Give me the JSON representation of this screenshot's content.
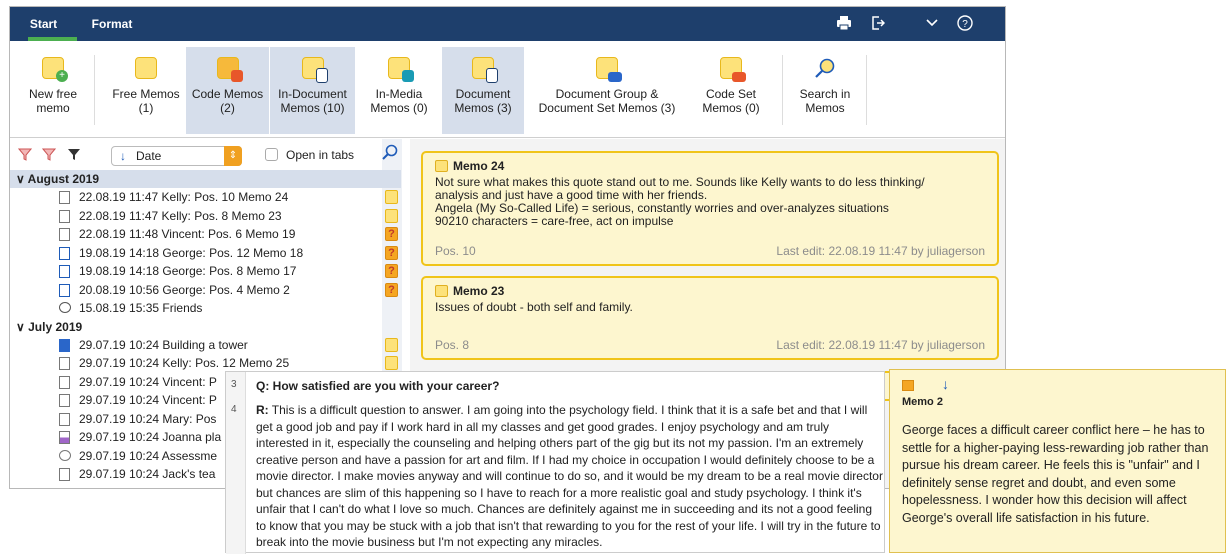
{
  "tabs": {
    "start": "Start",
    "format": "Format"
  },
  "ribbon": [
    {
      "name": "new-free-memo",
      "label": "New free memo",
      "selected": false
    },
    {
      "name": "free-memos",
      "label": "Free Memos (1)",
      "selected": false
    },
    {
      "name": "code-memos",
      "label": "Code Memos (2)",
      "selected": true
    },
    {
      "name": "in-document-memos",
      "label": "In-Document Memos (10)",
      "selected": true
    },
    {
      "name": "in-media-memos",
      "label": "In-Media Memos (0)",
      "selected": false
    },
    {
      "name": "document-memos",
      "label": "Document Memos (3)",
      "selected": true
    },
    {
      "name": "document-group-memos",
      "label": "Document Group & Document Set Memos (3)",
      "selected": false
    },
    {
      "name": "code-set-memos",
      "label": "Code Set Memos (0)",
      "selected": false
    },
    {
      "name": "search-in-memos",
      "label": "Search in Memos",
      "selected": false
    }
  ],
  "ribbon_labels": {
    "new_free_1": "New free",
    "new_free_2": "memo",
    "free_1": "Free Memos",
    "free_2": "(1)",
    "code_1": "Code Memos",
    "code_2": "(2)",
    "indoc_1": "In-Document",
    "indoc_2": "Memos (10)",
    "inmedia_1": "In-Media",
    "inmedia_2": "Memos (0)",
    "docm_1": "Document",
    "docm_2": "Memos (3)",
    "group_1": "Document Group &",
    "group_2": "Document Set Memos (3)",
    "codeset_1": "Code Set",
    "codeset_2": "Memos (0)",
    "search_1": "Search in",
    "search_2": "Memos"
  },
  "filter": {
    "sort": "Date",
    "open_in_tabs": "Open in tabs"
  },
  "groups": [
    {
      "label": "August 2019",
      "rows": [
        "22.08.19  11:47   Kelly: Pos. 10   Memo 24",
        "22.08.19  11:47   Kelly: Pos. 8   Memo 23",
        "22.08.19  11:48   Vincent: Pos. 6   Memo 19",
        "19.08.19  14:18   George: Pos. 12   Memo 18",
        "19.08.19  14:18   George: Pos. 8   Memo 17",
        "20.08.19  10:56   George: Pos. 4   Memo 2",
        "15.08.19  15:35   Friends"
      ]
    },
    {
      "label": "July 2019",
      "rows": [
        "29.07.19  10:24   Building a tower",
        "29.07.19  10:24   Kelly: Pos. 12   Memo 25",
        "29.07.19  10:24   Vincent: P",
        "29.07.19  10:24   Vincent: P",
        "29.07.19  10:24   Mary: Pos",
        "29.07.19  10:24   Joanna pla",
        "29.07.19  10:24   Assessme",
        "29.07.19  10:24   Jack's tea"
      ]
    }
  ],
  "memos": {
    "m24": {
      "title": "Memo 24",
      "line1": "Not sure what makes this quote stand out to me. Sounds like Kelly wants to do less thinking/",
      "line2": "analysis and just have a good time with her friends.",
      "line3": "Angela (My So-Called Life) = serious, constantly worries and over-analyzes situations",
      "line4": "90210 characters = care-free, act on impulse",
      "pos": "Pos. 10",
      "edit": "Last edit: 22.08.19 11:47 by juliagerson"
    },
    "m23": {
      "title": "Memo 23",
      "line1": "Issues of doubt - both self and family.",
      "pos": "Pos. 8",
      "edit": "Last edit: 22.08.19 11:47 by juliagerson"
    }
  },
  "document": {
    "line3": "3",
    "line4": "4",
    "question": "Q: How satisfied are you with your career?",
    "answer_label": "R:",
    "answer": "This is a difficult question to answer. I am going into the psychology field. I think that it is a safe bet and that I will get a good job and pay if I work hard in all my classes and get good grades. I enjoy psychology and am truly interested in it, especially the counseling and helping others part of the gig but its not my passion. I'm an extremely creative person and have a passion for art and film. If I had my choice in occupation I would definitely choose to be a movie director. I make movies anyway and will continue to do so, and it would be my dream to be a real movie director but chances are slim of this happening so I have to reach for a more realistic goal and study psychology. I think it's unfair that I can't do what I love so much. Chances are definitely against me in succeeding and its not a good feeling to know that you may be stuck with a job that isn't that rewarding to you for the rest of your life. I will try in the future to break into the movie business but I'm not expecting any miracles."
  },
  "memo_popup": {
    "title": "Memo 2",
    "text": "George faces a difficult career conflict here – he has to settle for a higher-paying less-rewarding job rather than pursue his dream career. He feels this is \"unfair\" and I definitely sense regret and doubt, and even some hopelessness. I wonder how this decision will affect George's overall life satisfaction in his future."
  }
}
